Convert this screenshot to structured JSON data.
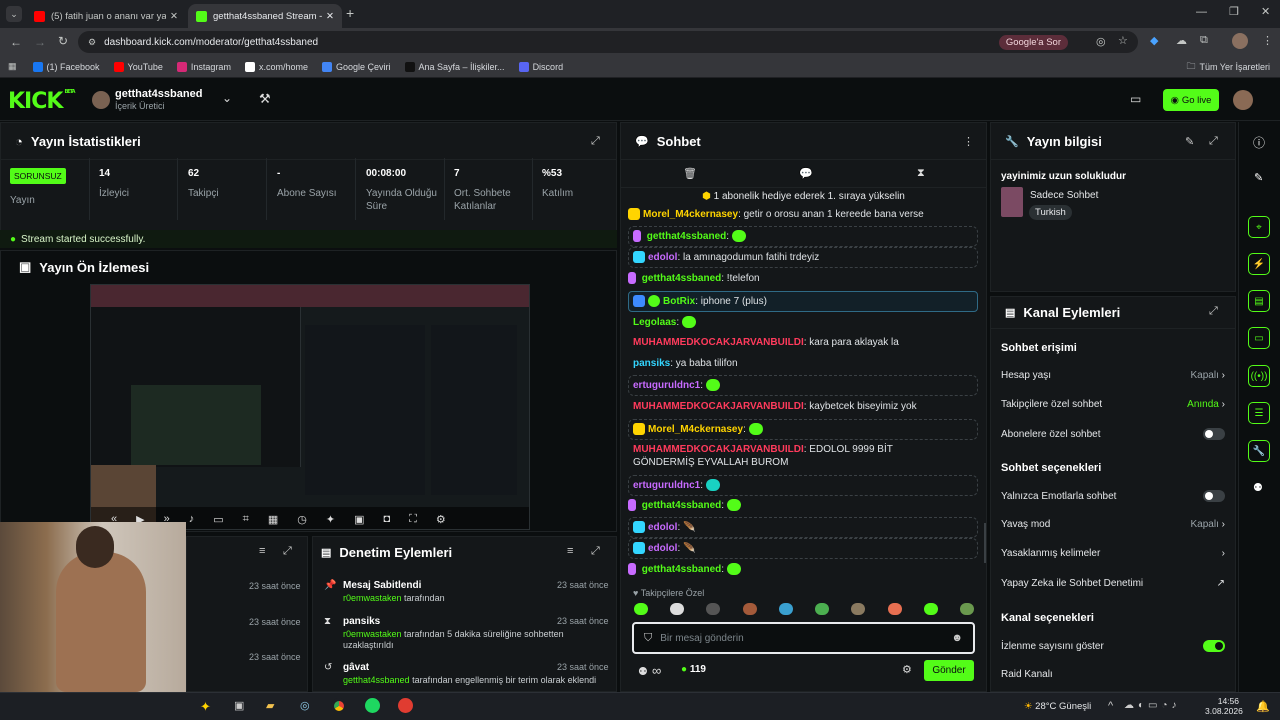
{
  "browser": {
    "tabs": [
      {
        "label": "(5) fatih juan o ananı var ya - Yo",
        "favicon_color": "#ff0000",
        "active": false
      },
      {
        "label": "getthat4ssbaned Stream - Kick",
        "favicon_color": "#53fc18",
        "active": true
      }
    ],
    "url": "dashboard.kick.com/moderator/getthat4ssbaned",
    "ask_google": "Google'a Sor",
    "bookmarks": [
      {
        "label": "(1) Facebook",
        "color": "#1877f2"
      },
      {
        "label": "YouTube",
        "color": "#ff0000"
      },
      {
        "label": "Instagram",
        "color": "#d62976"
      },
      {
        "label": "x.com/home",
        "color": "#ffffff"
      },
      {
        "label": "Google Çeviri",
        "color": "#4285f4"
      },
      {
        "label": "Ana Sayfa – İlişkiler...",
        "color": "#222222"
      },
      {
        "label": "Discord",
        "color": "#5865f2"
      }
    ],
    "all_bookmarks": "Tüm Yer İşaretleri"
  },
  "header": {
    "logo": "KICK",
    "logo_sup": "BETA",
    "channel_name": "getthat4ssbaned",
    "channel_role": "İçerik Üretici",
    "go_live": "Go live"
  },
  "stats": {
    "title": "Yayın İstatistikleri",
    "health_badge": "SORUNSUZ",
    "health_label": "Yayın",
    "items": [
      {
        "value": "14",
        "label": "İzleyici"
      },
      {
        "value": "62",
        "label": "Takipçi"
      },
      {
        "value": "-",
        "label": "Abone Sayısı"
      },
      {
        "value": "00:08:00",
        "label": "Yayında Olduğu Süre"
      },
      {
        "value": "7",
        "label": "Ort. Sohbete Katılanlar"
      },
      {
        "value": "%53",
        "label": "Katılım"
      }
    ],
    "success_msg": "Stream started successfully."
  },
  "preview": {
    "title": "Yayın Ön İzlemesi"
  },
  "mod_actions": {
    "title": "Denetim Eylemleri",
    "left_times": [
      "23 saat önce",
      "23 saat önce",
      "23 saat önce"
    ],
    "items": [
      {
        "icon": "pin-icon",
        "title": "Mesaj Sabitlendi",
        "by": "r0emwastaken",
        "rest": "tarafından",
        "time": "23 saat önce"
      },
      {
        "icon": "hourglass-icon",
        "title": "pansiks",
        "by": "r0emwastaken",
        "rest": "tarafından 5 dakika süreliğine sohbetten uzaklaştırıldı",
        "time": "23 saat önce"
      },
      {
        "icon": "undo-icon",
        "title": "gâvat",
        "by": "getthat4ssbaned",
        "rest": "tarafından engellenmiş bir terim olarak eklendi",
        "time": "23 saat önce"
      }
    ]
  },
  "chat": {
    "title": "Sohbet",
    "pinned_gift": "1 abonelik hediye ederek 1. sıraya yükselin",
    "messages": [
      {
        "user": "Morel_M4ckernasey",
        "color": "#ffd400",
        "text": ": getir o orosu anan 1 kereede bana verse"
      },
      {
        "user": "getthat4ssbaned",
        "color": "#53fc18",
        "text": ":"
      },
      {
        "user": "edolol",
        "color": "#c86bff",
        "text": ": la amınagodumun fatihi trdeyiz"
      },
      {
        "user": "getthat4ssbaned",
        "color": "#53fc18",
        "text": ": !telefon"
      },
      {
        "user": "BotRix",
        "color": "#53fc18",
        "text": ": iphone 7 (plus)"
      },
      {
        "user": "Legolaas",
        "color": "#53fc18",
        "text": ":"
      },
      {
        "user": "MUHAMMEDKOCAKJARVANBUILDI",
        "color": "#ff3b5c",
        "text": ": kara para aklayak la"
      },
      {
        "user": "pansiks",
        "color": "#33d6ff",
        "text": ": ya baba tilifon"
      },
      {
        "user": "ertuguruldnc1",
        "color": "#c86bff",
        "text": ":"
      },
      {
        "user": "MUHAMMEDKOCAKJARVANBUILDI",
        "color": "#ff3b5c",
        "text": ": kaybetcek biseyimiz yok"
      },
      {
        "user": "Morel_M4ckernasey",
        "color": "#ffd400",
        "text": ":"
      },
      {
        "user": "MUHAMMEDKOCAKJARVANBUILDI",
        "color": "#ff3b5c",
        "text": ": EDOLOL 9999 BİT GÖNDERMİŞ EYVALLAH BUROM"
      },
      {
        "user": "ertuguruldnc1",
        "color": "#c86bff",
        "text": ":"
      },
      {
        "user": "getthat4ssbaned",
        "color": "#53fc18",
        "text": ":"
      },
      {
        "user": "edolol",
        "color": "#c86bff",
        "text": ":"
      },
      {
        "user": "edolol",
        "color": "#c86bff",
        "text": ":"
      },
      {
        "user": "getthat4ssbaned",
        "color": "#53fc18",
        "text": ":"
      }
    ],
    "emote_section": "Takipçilere Özel",
    "input_placeholder": "Bir mesaj gönderin",
    "points": "119",
    "send": "Gönder"
  },
  "stream_info": {
    "title": "Yayın bilgisi",
    "stream_title": "yayinimiz uzun solukludur",
    "category": "Sadece Sohbet",
    "tag": "Turkish"
  },
  "channel_actions": {
    "title": "Kanal Eylemleri",
    "sections": [
      {
        "heading": "Sohbet erişimi"
      },
      {
        "heading": "Sohbet seçenekleri"
      },
      {
        "heading": "Kanal seçenekleri"
      }
    ],
    "rows": [
      {
        "label": "Hesap yaşı",
        "value": "Kapalı",
        "kind": "chevron"
      },
      {
        "label": "Takipçilere özel sohbet",
        "value": "Anında",
        "kind": "chevron"
      },
      {
        "label": "Abonelere özel sohbet",
        "value": "",
        "kind": "toggle_off"
      },
      {
        "label": "Yalnızca Emotlarla sohbet",
        "value": "",
        "kind": "toggle_off"
      },
      {
        "label": "Yavaş mod",
        "value": "Kapalı",
        "kind": "chevron"
      },
      {
        "label": "Yasaklanmış kelimeler",
        "value": "",
        "kind": "chevron"
      },
      {
        "label": "Yapay Zeka ile Sohbet Denetimi",
        "value": "",
        "kind": "external"
      },
      {
        "label": "İzlenme sayısını göster",
        "value": "",
        "kind": "toggle_on"
      },
      {
        "label": "Raid Kanalı",
        "value": "",
        "kind": "none"
      }
    ]
  },
  "taskbar": {
    "weather": "28°C  Güneşli",
    "time": "14:56",
    "date": "3.08.2026"
  }
}
